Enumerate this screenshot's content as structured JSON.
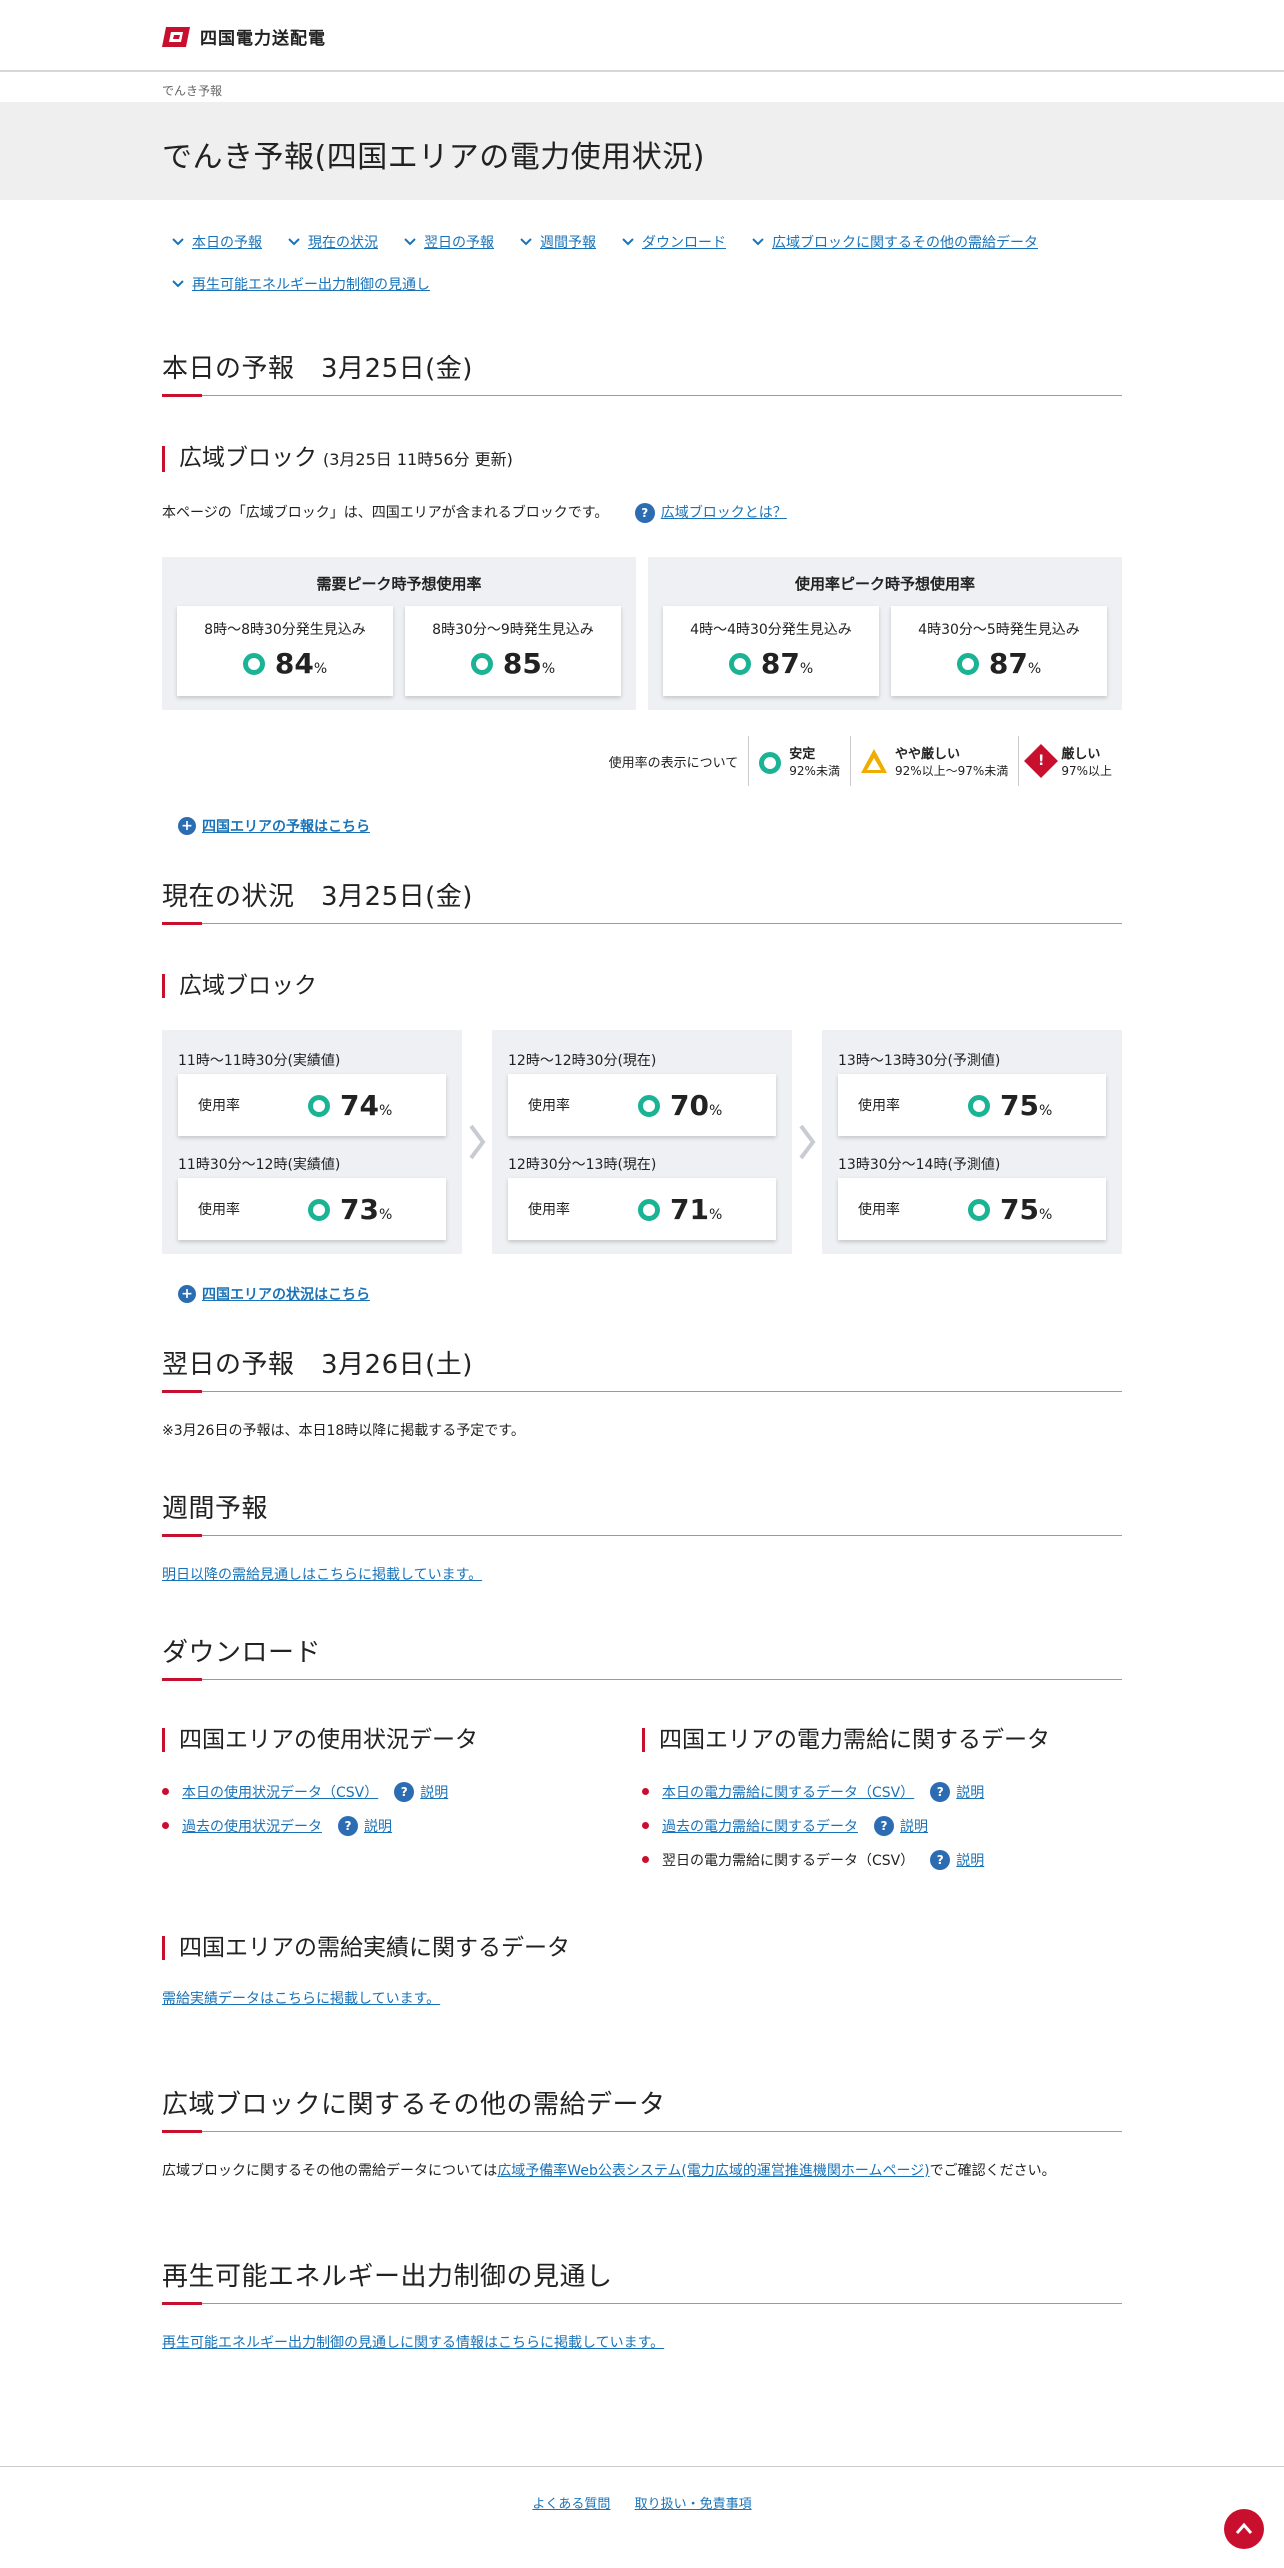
{
  "header": {
    "logo_text": "四国電力送配電"
  },
  "breadcrumb": "でんき予報",
  "page_title": "でんき予報(四国エリアの電力使用状況)",
  "anchor_nav": [
    "本日の予報",
    "現在の状況",
    "翌日の予報",
    "週間予報",
    "ダウンロード",
    "広域ブロックに関するその他の需給データ",
    "再生可能エネルギー出力制御の見通し"
  ],
  "today": {
    "heading": "本日の予報　3月25日(金)",
    "block_title": "広域ブロック",
    "block_updated": "(3月25日 11時56分 更新)",
    "note": "本ページの「広域ブロック」は、四国エリアが含まれるブロックです。",
    "help_link": "広域ブロックとは？",
    "panels": [
      {
        "title": "需要ピーク時予想使用率",
        "cards": [
          {
            "period": "8時〜8時30分発生見込み",
            "value": "84",
            "unit": "%"
          },
          {
            "period": "8時30分〜9時発生見込み",
            "value": "85",
            "unit": "%"
          }
        ]
      },
      {
        "title": "使用率ピーク時予想使用率",
        "cards": [
          {
            "period": "4時〜4時30分発生見込み",
            "value": "87",
            "unit": "%"
          },
          {
            "period": "4時30分〜5時発生見込み",
            "value": "87",
            "unit": "%"
          }
        ]
      }
    ],
    "legend": {
      "label": "使用率の表示について",
      "items": [
        {
          "name": "安定",
          "range": "92%未満",
          "color": "#1ab394"
        },
        {
          "name": "やや厳しい",
          "range": "92%以上〜97%未満",
          "color": "#f0ad00"
        },
        {
          "name": "厳しい",
          "range": "97%以上",
          "color": "#c8102e"
        }
      ]
    },
    "more_link": "四国エリアの予報はこちら"
  },
  "current": {
    "heading": "現在の状況　3月25日(金)",
    "block_title": "広域ブロック",
    "panels": [
      {
        "rows": [
          {
            "period": "11時〜11時30分(実績値)",
            "label": "使用率",
            "value": "74",
            "unit": "%"
          },
          {
            "period": "11時30分〜12時(実績値)",
            "label": "使用率",
            "value": "73",
            "unit": "%"
          }
        ]
      },
      {
        "rows": [
          {
            "period": "12時〜12時30分(現在)",
            "label": "使用率",
            "value": "70",
            "unit": "%"
          },
          {
            "period": "12時30分〜13時(現在)",
            "label": "使用率",
            "value": "71",
            "unit": "%"
          }
        ]
      },
      {
        "rows": [
          {
            "period": "13時〜13時30分(予測値)",
            "label": "使用率",
            "value": "75",
            "unit": "%"
          },
          {
            "period": "13時30分〜14時(予測値)",
            "label": "使用率",
            "value": "75",
            "unit": "%"
          }
        ]
      }
    ],
    "more_link": "四国エリアの状況はこちら"
  },
  "tomorrow": {
    "heading": "翌日の予報　3月26日(土)",
    "note": "※3月26日の予報は、本日18時以降に掲載する予定です。"
  },
  "weekly": {
    "heading": "週間予報",
    "link": "明日以降の需給見通しはこちらに掲載しています。"
  },
  "download": {
    "heading": "ダウンロード",
    "usage_title": "四国エリアの使用状況データ",
    "usage_items": [
      {
        "label": "本日の使用状況データ（CSV）",
        "help": "説明"
      },
      {
        "label": "過去の使用状況データ",
        "help": "説明"
      }
    ],
    "supply_title": "四国エリアの電力需給に関するデータ",
    "supply_items": [
      {
        "label": "本日の電力需給に関するデータ（CSV）",
        "help": "説明"
      },
      {
        "label": "過去の電力需給に関するデータ",
        "help": "説明"
      },
      {
        "label": "翌日の電力需給に関するデータ（CSV）",
        "help": "説明"
      }
    ],
    "results_title": "四国エリアの需給実績に関するデータ",
    "results_link": "需給実績データはこちらに掲載しています。"
  },
  "other": {
    "heading": "広域ブロックに関するその他の需給データ",
    "text_before": "広域ブロックに関するその他の需給データについては",
    "link": "広域予備率Web公表システム(電力広域的運営推進機関ホームページ)",
    "text_after": "でご確認ください。"
  },
  "renewable": {
    "heading": "再生可能エネルギー出力制御の見通し",
    "link": "再生可能エネルギー出力制御の見通しに関する情報はこちらに掲載しています。"
  },
  "footer": {
    "links": [
      "よくある質問",
      "取り扱い・免責事項"
    ]
  },
  "colors": {
    "brand": "#c8102e",
    "link": "#1a73b8",
    "stable": "#1ab394",
    "panel_bg": "#eef0f3"
  }
}
